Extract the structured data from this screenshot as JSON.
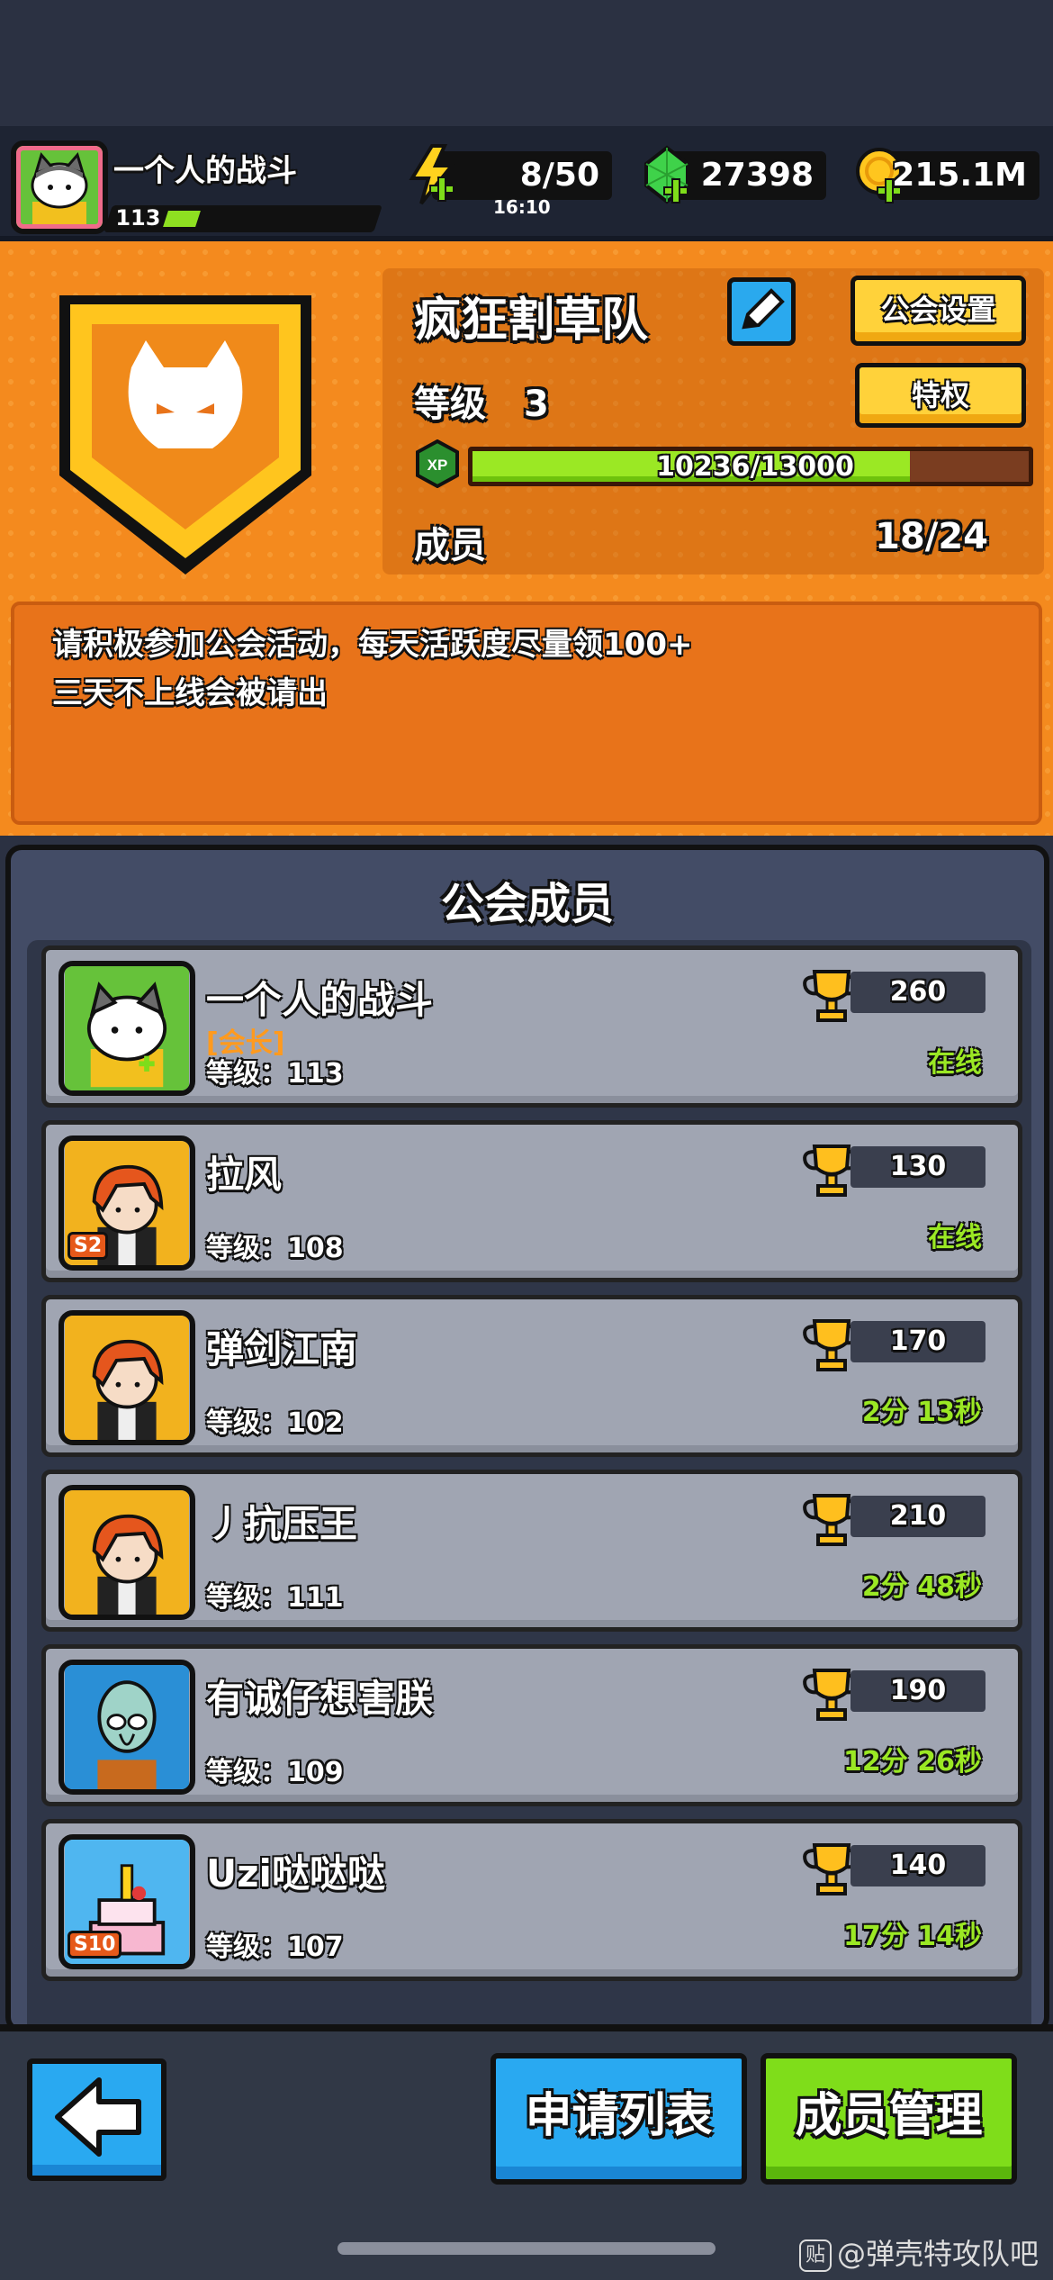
{
  "player": {
    "name": "一个人的战斗",
    "level": "113"
  },
  "resources": {
    "energy": {
      "value": "8/50",
      "timer": "16:10",
      "icon": "lightning-icon"
    },
    "gems": {
      "value": "27398",
      "icon": "gem-icon"
    },
    "coins": {
      "value": "215.1M",
      "icon": "coin-icon"
    }
  },
  "guild": {
    "name": "疯狂割草队",
    "settings_label": "公会设置",
    "privilege_label": "特权",
    "level_label": "等级",
    "level_value": "3",
    "xp_text": "10236/13000",
    "xp_fraction": 0.787,
    "xp_icon_label": "XP",
    "members_label": "成员",
    "members_count": "18/24",
    "notice_line1": "请积极参加公会活动，每天活跃度尽量领100+",
    "notice_line2": "三天不上线会被请出"
  },
  "members_panel": {
    "title": "公会成员",
    "rows": [
      {
        "name": "一个人的战斗",
        "role": "[会长]",
        "level": "等级：113",
        "trophies": "260",
        "status": "在线",
        "avatar": "cat"
      },
      {
        "name": "拉风",
        "role": "",
        "level": "等级：108",
        "trophies": "130",
        "status": "在线",
        "avatar": "redhair",
        "tag": "S2"
      },
      {
        "name": "弹剑江南",
        "role": "",
        "level": "等级：102",
        "trophies": "170",
        "status": "2分 13秒",
        "avatar": "redhair"
      },
      {
        "name": "丿抗压王",
        "role": "",
        "level": "等级：111",
        "trophies": "210",
        "status": "2分 48秒",
        "avatar": "redhair"
      },
      {
        "name": "有诚仔想害朕",
        "role": "",
        "level": "等级：109",
        "trophies": "190",
        "status": "12分 26秒",
        "avatar": "squid"
      },
      {
        "name": "Uzi哒哒哒",
        "role": "",
        "level": "等级：107",
        "trophies": "140",
        "status": "17分 14秒",
        "avatar": "cake",
        "tag": "S10"
      }
    ]
  },
  "bottom": {
    "apply_list_label": "申请列表",
    "manage_label": "成员管理"
  },
  "watermark": {
    "text": "@弹壳特攻队吧",
    "icon_label": "贴"
  },
  "colors": {
    "accent_orange": "#f48a1e",
    "online_green": "#9be824",
    "button_blue": "#29a9f1",
    "button_green": "#7fdd1a"
  }
}
